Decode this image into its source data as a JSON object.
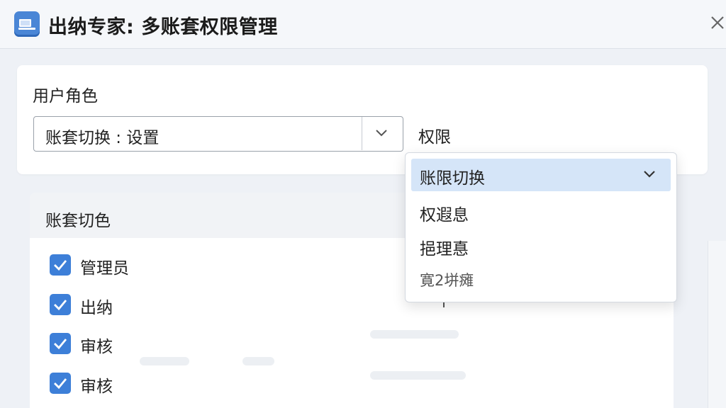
{
  "window": {
    "title": "出纳专家: 多账套权限管理"
  },
  "icons": {
    "app": "app-logo-icon",
    "close": "close-icon",
    "chevron": "chevron-down-icon",
    "check": "checkmark-icon"
  },
  "role_section": {
    "label": "用户角色",
    "account_select_value": "账套切换 : 设置",
    "permission_label": "权限"
  },
  "permission_dropdown": {
    "options": [
      {
        "label": "账限切换",
        "selected": true
      },
      {
        "label": "权遐息",
        "selected": false
      },
      {
        "label": "挹理惪",
        "selected": false
      },
      {
        "label": "寛2垪瘫",
        "selected": false
      }
    ]
  },
  "account_roles": {
    "header": "账套切色",
    "items": [
      {
        "label": "管理员",
        "checked": true
      },
      {
        "label": "出纳",
        "checked": true
      },
      {
        "label": "审核",
        "checked": true
      },
      {
        "label": "审核",
        "checked": true
      }
    ]
  },
  "colors": {
    "accent": "#3d7fd8",
    "selected_bg": "#d5e5f8",
    "app_icon": "#4a86d6"
  }
}
